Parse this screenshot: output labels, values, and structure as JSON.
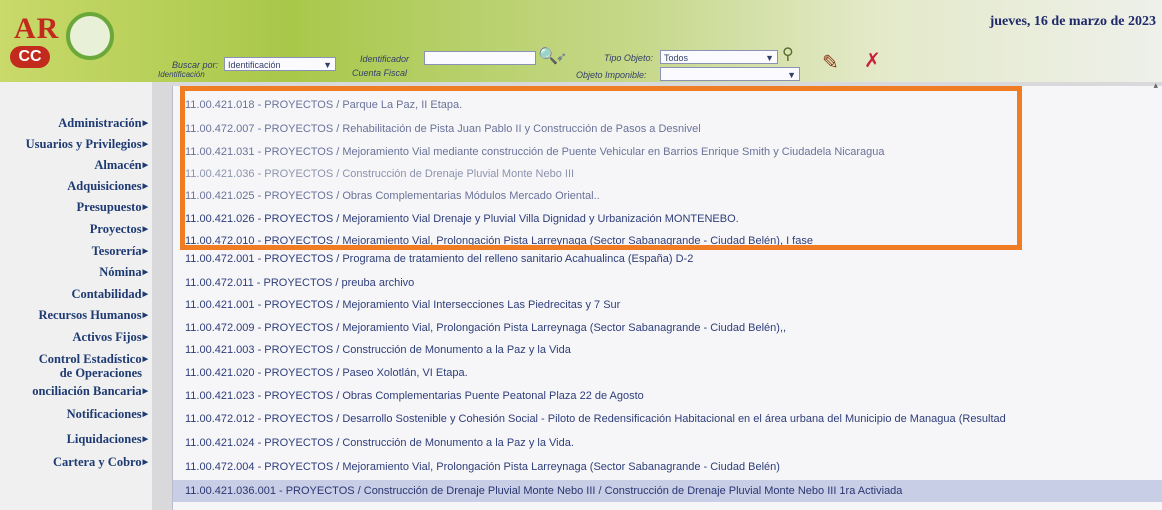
{
  "header": {
    "logo": {
      "ar": "AR",
      "cc": "CC"
    },
    "date": "jueves, 16 de marzo de 2023"
  },
  "toolbar": {
    "buscar_por_label": "Buscar por:",
    "buscar_por_value": "Identificación",
    "identificador_label": "Identificador",
    "identificador_value": "",
    "cuenta_fiscal_label": "Cuenta Fiscal",
    "tipo_objeto_label": "Tipo Objeto:",
    "tipo_objeto_value": "Todos",
    "objeto_imponible_label": "Objeto Imponible:",
    "objeto_imponible_value": "",
    "identificacion_label": "Identificación"
  },
  "sidebar": {
    "items": [
      {
        "label": "Administración"
      },
      {
        "label": "Usuarios y Privilegios"
      },
      {
        "label": "Almacén"
      },
      {
        "label": "Adquisiciones"
      },
      {
        "label": "Presupuesto"
      },
      {
        "label": "Proyectos"
      },
      {
        "label": "Tesorería"
      },
      {
        "label": "Nómina"
      },
      {
        "label": "Contabilidad"
      },
      {
        "label": "Recursos Humanos"
      },
      {
        "label": "Activos Fijos"
      },
      {
        "label": "Control Estadístico"
      },
      {
        "label": "de Operaciones"
      },
      {
        "label": "onciliación Bancaria"
      },
      {
        "label": "Notificaciones"
      },
      {
        "label": "Liquidaciones"
      },
      {
        "label": "Cartera y Cobro"
      }
    ]
  },
  "list": {
    "rows": [
      {
        "text": "11.00.421.018 - PROYECTOS / Parque La Paz, II Etapa."
      },
      {
        "text": "11.00.472.007 - PROYECTOS / Rehabilitación de Pista Juan Pablo II y Construcción de Pasos a Desnivel"
      },
      {
        "text": "11.00.421.031 - PROYECTOS / Mejoramiento Vial mediante construcción de Puente Vehicular en Barrios Enrique Smith y Ciudadela Nicaragua"
      },
      {
        "text": "11.00.421.036 - PROYECTOS / Construcción de Drenaje Pluvial Monte Nebo III"
      },
      {
        "text": "11.00.421.025 - PROYECTOS / Obras Complementarias Módulos Mercado Oriental.."
      },
      {
        "text": "11.00.421.026 - PROYECTOS / Mejoramiento Vial Drenaje y Pluvial Villa Dignidad y Urbanización MONTENEBO."
      },
      {
        "text": "11.00.472.010 - PROYECTOS / Mejoramiento Vial, Prolongación Pista Larreynaga (Sector Sabanagrande - Ciudad Belén), I fase"
      },
      {
        "text": "11.00.472.001 - PROYECTOS / Programa de tratamiento del relleno sanitario Acahualinca (España) D-2"
      },
      {
        "text": "11.00.472.011 - PROYECTOS / preuba archivo"
      },
      {
        "text": "11.00.421.001 - PROYECTOS / Mejoramiento Vial Intersecciones Las Piedrecitas y 7 Sur"
      },
      {
        "text": "11.00.472.009 - PROYECTOS / Mejoramiento Vial, Prolongación Pista Larreynaga (Sector Sabanagrande - Ciudad Belén),,"
      },
      {
        "text": "11.00.421.003 - PROYECTOS / Construcción de Monumento a la Paz y la Vida"
      },
      {
        "text": "11.00.421.020 - PROYECTOS / Paseo Xolotlán, VI Etapa."
      },
      {
        "text": "11.00.421.023 - PROYECTOS / Obras Complementarias Puente Peatonal Plaza 22 de Agosto"
      },
      {
        "text": "11.00.472.012 - PROYECTOS / Desarrollo Sostenible y Cohesión Social - Piloto de Redensificación Habitacional en el área urbana del Municipio de Managua (Resultad"
      },
      {
        "text": "11.00.421.024 - PROYECTOS / Construcción de Monumento a la Paz y la Vida."
      },
      {
        "text": "11.00.472.004 - PROYECTOS / Mejoramiento Vial, Prolongación Pista Larreynaga (Sector Sabanagrande - Ciudad Belén)"
      },
      {
        "text": "11.00.421.036.001 - PROYECTOS / Construcción de Drenaje Pluvial Monte Nebo III / Construcción de Drenaje Pluvial Monte Nebo III 1ra Activiada"
      }
    ]
  },
  "colors": {
    "highlight_border": "#f07c24",
    "menu_text": "#1e3a72",
    "logo_red": "#c32a1e",
    "logo_green": "#6aa83a"
  }
}
